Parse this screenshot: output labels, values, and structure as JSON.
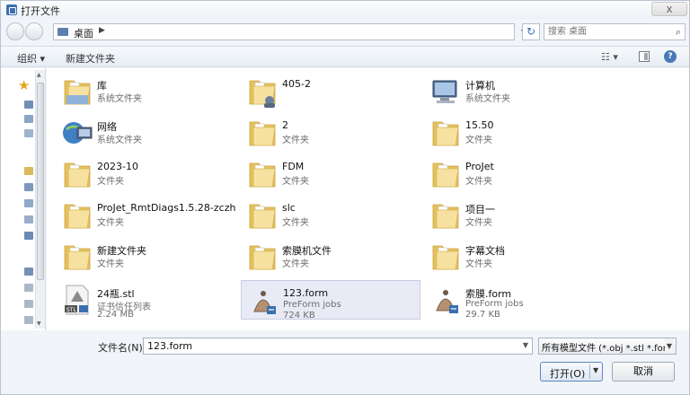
{
  "window": {
    "title": "打开文件",
    "close_glyph": "x"
  },
  "address": {
    "location": "桌面",
    "search_placeholder": "搜索 桌面"
  },
  "toolbar": {
    "organize": "组织 ▾",
    "new_folder": "新建文件夹"
  },
  "items": [
    {
      "name": "库",
      "sub": "系统文件夹",
      "icon": "library-icon"
    },
    {
      "name": "405-2",
      "sub": "",
      "icon": "user-folder-icon"
    },
    {
      "name": "计算机",
      "sub": "系统文件夹",
      "icon": "computer-icon"
    },
    {
      "name": "网络",
      "sub": "系统文件夹",
      "icon": "network-icon"
    },
    {
      "name": "2",
      "sub": "文件夹",
      "icon": "folder-icon"
    },
    {
      "name": "15.50",
      "sub": "文件夹",
      "icon": "folder-icon"
    },
    {
      "name": "2023-10",
      "sub": "文件夹",
      "icon": "folder-icon"
    },
    {
      "name": "FDM",
      "sub": "文件夹",
      "icon": "folder-icon"
    },
    {
      "name": "ProJet",
      "sub": "文件夹",
      "icon": "folder-icon"
    },
    {
      "name": "ProJet_RmtDiags1.5.28-zczh",
      "sub": "文件夹",
      "icon": "folder-icon"
    },
    {
      "name": "slc",
      "sub": "文件夹",
      "icon": "folder-icon"
    },
    {
      "name": "项目一",
      "sub": "文件夹",
      "icon": "folder-icon"
    },
    {
      "name": "新建文件夹",
      "sub": "文件夹",
      "icon": "folder-icon"
    },
    {
      "name": "索膜机文件",
      "sub": "文件夹",
      "icon": "folder-icon"
    },
    {
      "name": "字幕文档",
      "sub": "文件夹",
      "icon": "folder-icon"
    },
    {
      "name": "24瓶.stl",
      "sub": "证书信任列表",
      "sub2": "2.24 MB",
      "icon": "stl-file-icon"
    },
    {
      "name": "123.form",
      "sub": "PreForm jobs",
      "sub2": "724 KB",
      "icon": "form-file-icon",
      "selected": true
    },
    {
      "name": "索膜.form",
      "sub": "PreForm jobs",
      "sub2": "29.7 KB",
      "icon": "form-file-icon"
    }
  ],
  "bottom": {
    "filename_label": "文件名(N):",
    "filename_value": "123.form",
    "filetype_value": "所有模型文件 (*.obj *.stl *.fon",
    "open_label": "打开(O)",
    "cancel_label": "取消"
  },
  "colors": {
    "selection": "#e8ebf6",
    "folder": "#f1d27c",
    "accent": "#4b79b8"
  }
}
